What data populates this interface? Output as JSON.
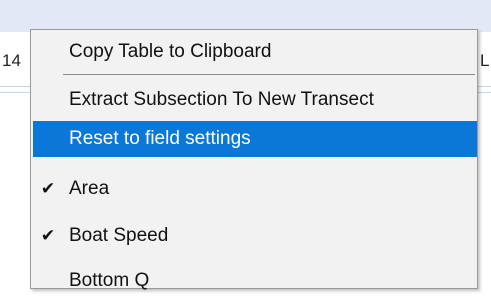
{
  "background": {
    "left_cell_text": "14",
    "right_cell_text": "L"
  },
  "context_menu": {
    "items": [
      {
        "label": "Copy Table to Clipboard",
        "checked": false,
        "highlighted": false
      },
      {
        "label": "Extract Subsection To New Transect",
        "checked": false,
        "highlighted": false
      },
      {
        "label": "Reset to field settings",
        "checked": false,
        "highlighted": true
      },
      {
        "label": "Area",
        "checked": true,
        "highlighted": false
      },
      {
        "label": "Boat Speed",
        "checked": true,
        "highlighted": false
      },
      {
        "label": "Bottom Q",
        "checked": false,
        "highlighted": false
      }
    ],
    "check_glyph": "✔",
    "highlight_color": "#0b78d7"
  }
}
